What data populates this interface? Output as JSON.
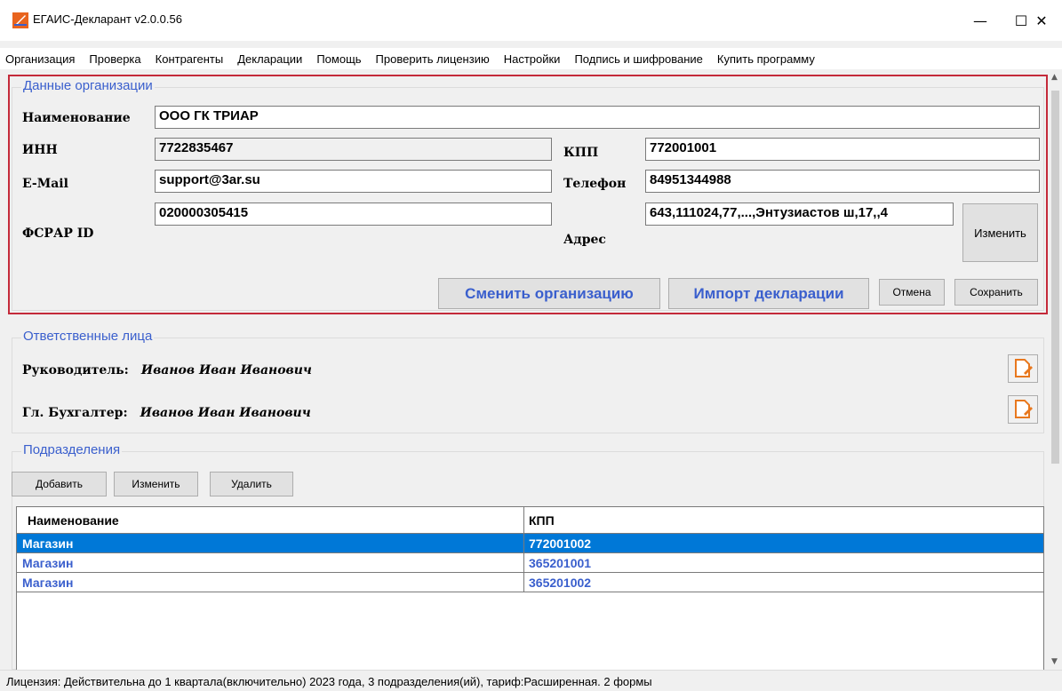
{
  "window": {
    "title": "ЕГАИС-Декларант v2.0.0.56",
    "minimize_glyph": "—",
    "maximize_glyph": "☐",
    "close_glyph": "✕"
  },
  "menu": {
    "items": [
      "Организация",
      "Проверка",
      "Контрагенты",
      "Декларации",
      "Помощь",
      "Проверить лицензию",
      "Настройки",
      "Подпись и шифрование",
      "Купить программу"
    ]
  },
  "org": {
    "legend": "Данные организации",
    "name_label": "Наименование",
    "name_value": "ООО ГК ТРИАР",
    "inn_label": "ИНН",
    "inn_value": "7722835467",
    "kpp_label": "КПП",
    "kpp_value": "772001001",
    "email_label": "E-Mail",
    "email_value": "support@3ar.su",
    "phone_label": "Телефон",
    "phone_value": "84951344988",
    "fsrar_label": "ФСРАР ID",
    "fsrar_value": "020000305415",
    "address_label": "Адрес",
    "address_value": "643,111024,77,...,Энтузиастов ш,17,,4",
    "change_button": "Изменить",
    "switch_org_button": "Сменить организацию",
    "import_button": "Импорт декларации",
    "cancel_button": "Отмена",
    "save_button": "Сохранить"
  },
  "responsible": {
    "legend": "Ответственные лица",
    "director_label": "Руководитель:",
    "director_name": "Иванов Иван Иванович",
    "accountant_label": "Гл. Бухгалтер:",
    "accountant_name": "Иванов Иван Иванович",
    "edit_icon": "edit-document-icon"
  },
  "divisions": {
    "legend": "Подразделения",
    "add_button": "Добавить",
    "edit_button": "Изменить",
    "delete_button": "Удалить",
    "columns": [
      "Наименование",
      "КПП"
    ],
    "rows": [
      {
        "name": "Магазин",
        "kpp": "772001002",
        "selected": true
      },
      {
        "name": "Магазин",
        "kpp": "365201001",
        "selected": false
      },
      {
        "name": "Магазин",
        "kpp": "365201002",
        "selected": false
      }
    ]
  },
  "status": {
    "text": "Лицензия: Действительна до 1 квартала(включительно) 2023 года, 3 подразделения(ий), тариф:Расширенная. 2 формы"
  },
  "colors": {
    "accent": "#3a5fcd",
    "highlight_frame": "#c42a3a",
    "selection": "#0078d7",
    "icon_orange": "#e8781e"
  }
}
